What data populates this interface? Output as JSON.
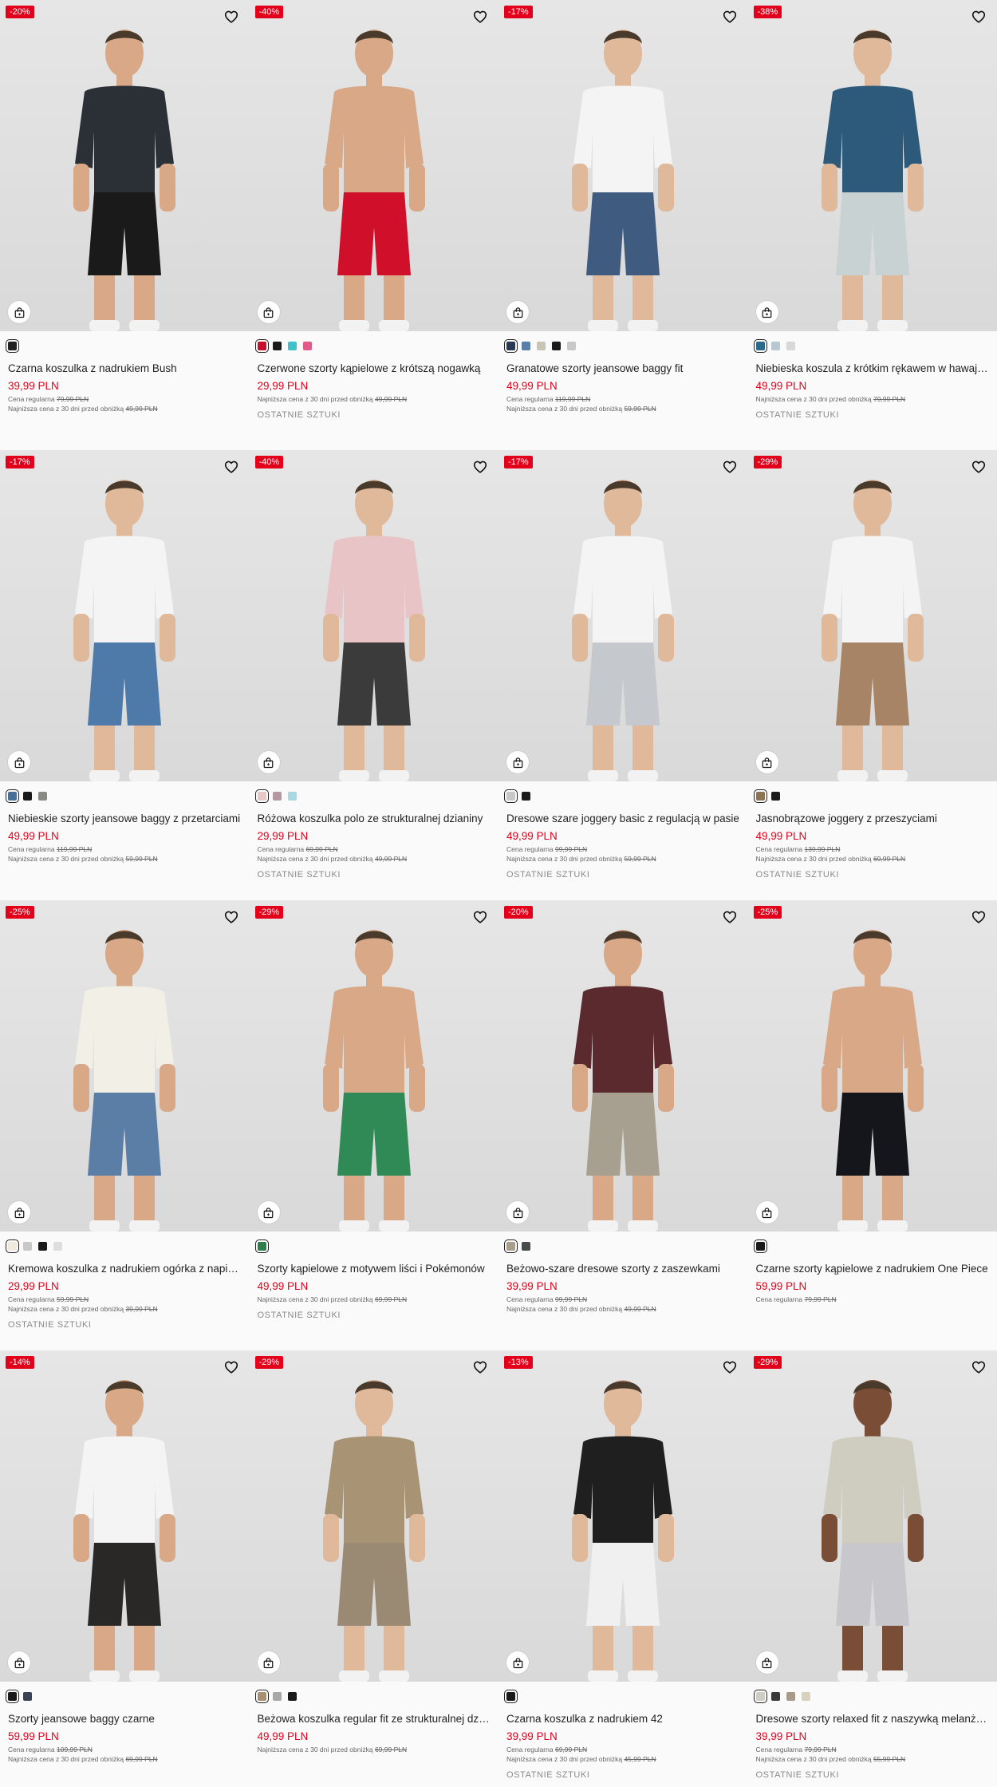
{
  "labels": {
    "regular_prefix": "Cena regularna",
    "lowest_prefix": "Najniższa cena z 30 dni przed obniżką",
    "last_pieces": "OSTATNIE SZTUKI"
  },
  "colors": {
    "sale_red": "#e3001b",
    "badge_text": "#ffffff",
    "page_bg": "#ffffff"
  },
  "products": [
    {
      "badge": "-20%",
      "name": "Czarna koszulka z nadrukiem Bush",
      "price": "39,99 PLN",
      "regular": "79,99 PLN",
      "lowest": "49,99 PLN",
      "last": "",
      "swatches": [
        "#222222"
      ],
      "top": "#2b2f36",
      "bottom": "#1a1a1a",
      "skin": "#d8a887"
    },
    {
      "badge": "-40%",
      "name": "Czerwone szorty kąpielowe z krótszą nogawką",
      "price": "29,99 PLN",
      "regular": "",
      "lowest": "49,99 PLN",
      "last": "OSTATNIE SZTUKI",
      "swatches": [
        "#c8102e",
        "#1a1a1a",
        "#3fc1c9",
        "#e05a8a"
      ],
      "top": "#d8a887",
      "bottom": "#d0102a",
      "skin": "#d8a887"
    },
    {
      "badge": "-17%",
      "name": "Granatowe szorty jeansowe baggy fit",
      "price": "49,99 PLN",
      "regular": "119,99 PLN",
      "lowest": "59,99 PLN",
      "last": "",
      "swatches": [
        "#2a3a55",
        "#5a7fa8",
        "#c9c5b5",
        "#1a1a1a",
        "#c8c8c8"
      ],
      "top": "#f4f4f4",
      "bottom": "#3f5c80",
      "skin": "#e0b89a"
    },
    {
      "badge": "-38%",
      "name": "Niebieska koszula z krótkim rękawem w hawajski wzór",
      "price": "49,99 PLN",
      "regular": "",
      "lowest": "79,99 PLN",
      "last": "OSTATNIE SZTUKI",
      "swatches": [
        "#2b6a8a",
        "#b7c8d3",
        "#d8d8d8"
      ],
      "top": "#2d5a7a",
      "bottom": "#c9d2d2",
      "skin": "#e0b89a"
    },
    {
      "badge": "-17%",
      "name": "Niebieskie szorty jeansowe baggy z przetarciami",
      "price": "49,99 PLN",
      "regular": "119,99 PLN",
      "lowest": "59,99 PLN",
      "last": "",
      "swatches": [
        "#4a6f96",
        "#1a1a1a",
        "#8a8a84"
      ],
      "top": "#f4f4f4",
      "bottom": "#4d7aa8",
      "skin": "#e0b89a"
    },
    {
      "badge": "-40%",
      "name": "Różowa koszulka polo ze strukturalnej dzianiny",
      "price": "29,99 PLN",
      "regular": "69,99 PLN",
      "lowest": "49,99 PLN",
      "last": "OSTATNIE SZTUKI",
      "swatches": [
        "#e8c7c7",
        "#b49aa0",
        "#a8d8e4"
      ],
      "top": "#e9c4c6",
      "bottom": "#3b3b3b",
      "skin": "#e0b89a"
    },
    {
      "badge": "-17%",
      "name": "Dresowe szare joggery basic z regulacją w pasie",
      "price": "49,99 PLN",
      "regular": "99,99 PLN",
      "lowest": "59,99 PLN",
      "last": "OSTATNIE SZTUKI",
      "swatches": [
        "#c8c8c8",
        "#1a1a1a"
      ],
      "top": "#f4f4f4",
      "bottom": "#c5c8cc",
      "skin": "#e0b89a"
    },
    {
      "badge": "-29%",
      "name": "Jasnobrązowe joggery z przeszyciami",
      "price": "49,99 PLN",
      "regular": "139,99 PLN",
      "lowest": "69,99 PLN",
      "last": "OSTATNIE SZTUKI",
      "swatches": [
        "#8b7355",
        "#1a1a1a"
      ],
      "top": "#f4f4f4",
      "bottom": "#a88466",
      "skin": "#e0b89a"
    },
    {
      "badge": "-25%",
      "name": "Kremowa koszulka z nadrukiem ogórka z napisem",
      "price": "29,99 PLN",
      "regular": "59,99 PLN",
      "lowest": "39,99 PLN",
      "last": "OSTATNIE SZTUKI",
      "swatches": [
        "#efeadc",
        "#c8c8c8",
        "#1a1a1a",
        "#dedede"
      ],
      "top": "#f1efe6",
      "bottom": "#5a7ea6",
      "skin": "#d8a887"
    },
    {
      "badge": "-29%",
      "name": "Szorty kąpielowe z motywem liści i Pokémonów",
      "price": "49,99 PLN",
      "regular": "",
      "lowest": "69,99 PLN",
      "last": "OSTATNIE SZTUKI",
      "swatches": [
        "#2e7d4a"
      ],
      "top": "#d8a887",
      "bottom": "#2f8a56",
      "skin": "#d8a887"
    },
    {
      "badge": "-20%",
      "name": "Beżowo-szare dresowe szorty z zaszewkami",
      "price": "39,99 PLN",
      "regular": "99,99 PLN",
      "lowest": "49,99 PLN",
      "last": "",
      "swatches": [
        "#a89f8a",
        "#4a4a4a"
      ],
      "top": "#5a2a2e",
      "bottom": "#a79f90",
      "skin": "#d8a887"
    },
    {
      "badge": "-25%",
      "name": "Czarne szorty kąpielowe z nadrukiem One Piece",
      "price": "59,99 PLN",
      "regular": "79,99 PLN",
      "lowest": "",
      "last": "",
      "swatches": [
        "#1a1a1a"
      ],
      "top": "#d8a887",
      "bottom": "#15151c",
      "skin": "#d8a887"
    },
    {
      "badge": "-14%",
      "name": "Szorty jeansowe baggy czarne",
      "price": "59,99 PLN",
      "regular": "109,99 PLN",
      "lowest": "69,99 PLN",
      "last": "",
      "swatches": [
        "#1a1a1a",
        "#3a4258"
      ],
      "top": "#f4f4f4",
      "bottom": "#2a2826",
      "skin": "#d8a887"
    },
    {
      "badge": "-29%",
      "name": "Beżowa koszulka regular fit ze strukturalnej dzianiny",
      "price": "49,99 PLN",
      "regular": "",
      "lowest": "69,99 PLN",
      "last": "",
      "swatches": [
        "#a89070",
        "#a8a8a8",
        "#1a1a1a"
      ],
      "top": "#a89474",
      "bottom": "#9a8a74",
      "skin": "#e0b89a"
    },
    {
      "badge": "-13%",
      "name": "Czarna koszulka z nadrukiem 42",
      "price": "39,99 PLN",
      "regular": "69,99 PLN",
      "lowest": "45,99 PLN",
      "last": "OSTATNIE SZTUKI",
      "swatches": [
        "#1a1a1a"
      ],
      "top": "#1f1f1f",
      "bottom": "#f0f0f0",
      "skin": "#e0b89a"
    },
    {
      "badge": "-29%",
      "name": "Dresowe szorty relaxed fit z naszywką melanżowe",
      "price": "39,99 PLN",
      "regular": "79,99 PLN",
      "lowest": "55,99 PLN",
      "last": "OSTATNIE SZTUKI",
      "swatches": [
        "#cfcdc4",
        "#3a3a3a",
        "#a89a88",
        "#d8d2bc"
      ],
      "top": "#cfccc0",
      "bottom": "#c8c8cc",
      "skin": "#7a4e36"
    }
  ]
}
